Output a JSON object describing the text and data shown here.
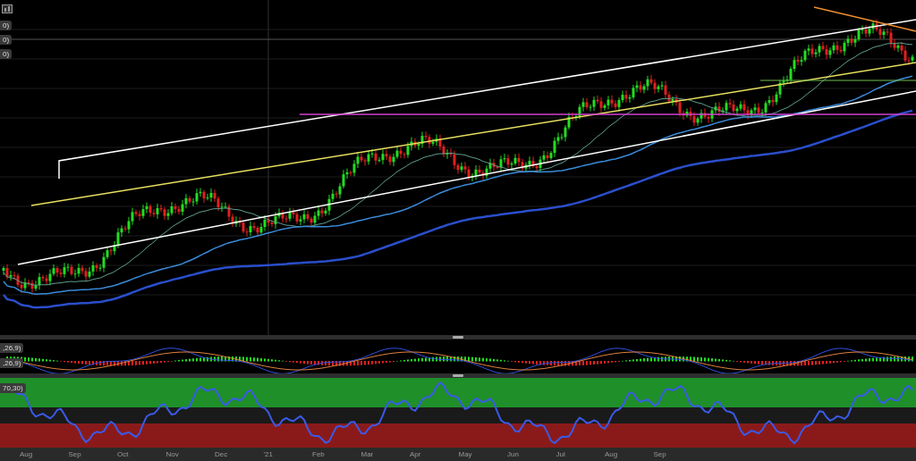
{
  "main_panel": {
    "legends": [
      "0)",
      "0)",
      "0)"
    ]
  },
  "macd_panel": {
    "legends": [
      ",26,9)",
      ",26,9)"
    ]
  },
  "rsi_panel": {
    "legend": "70,30)"
  },
  "time_axis": {
    "labels": [
      "Aug",
      "Sep",
      "Oct",
      "Nov",
      "Dec",
      "'21",
      "Feb",
      "Mar",
      "Apr",
      "May",
      "Jun",
      "Jul",
      "Aug",
      "Sep"
    ]
  }
}
